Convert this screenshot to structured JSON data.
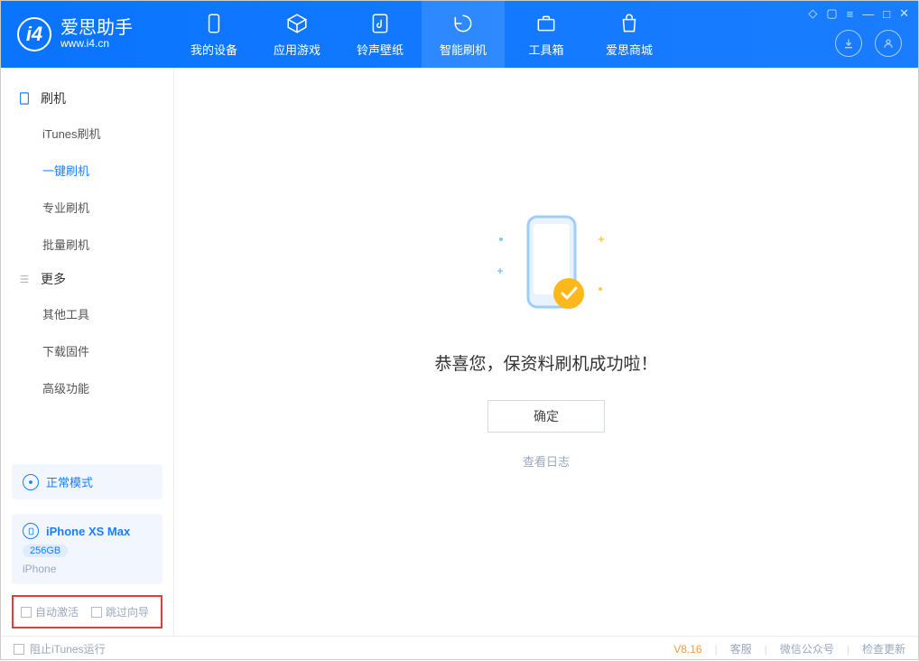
{
  "app": {
    "name": "爱思助手",
    "url": "www.i4.cn"
  },
  "topTabs": {
    "device": "我的设备",
    "apps": "应用游戏",
    "ringtone": "铃声壁纸",
    "flash": "智能刷机",
    "toolbox": "工具箱",
    "store": "爱思商城"
  },
  "sidebar": {
    "group1": "刷机",
    "items1": {
      "itunes": "iTunes刷机",
      "onekey": "一键刷机",
      "pro": "专业刷机",
      "batch": "批量刷机"
    },
    "group2": "更多",
    "items2": {
      "other": "其他工具",
      "firmware": "下载固件",
      "advanced": "高级功能"
    }
  },
  "mode": {
    "label": "正常模式"
  },
  "device": {
    "name": "iPhone XS Max",
    "capacity": "256GB",
    "type": "iPhone"
  },
  "options": {
    "autoActivate": "自动激活",
    "skipGuide": "跳过向导"
  },
  "result": {
    "message": "恭喜您，保资料刷机成功啦！",
    "ok": "确定",
    "viewLog": "查看日志"
  },
  "footer": {
    "blockItunes": "阻止iTunes运行",
    "version": "V8.16",
    "service": "客服",
    "wechat": "微信公众号",
    "update": "检查更新"
  }
}
